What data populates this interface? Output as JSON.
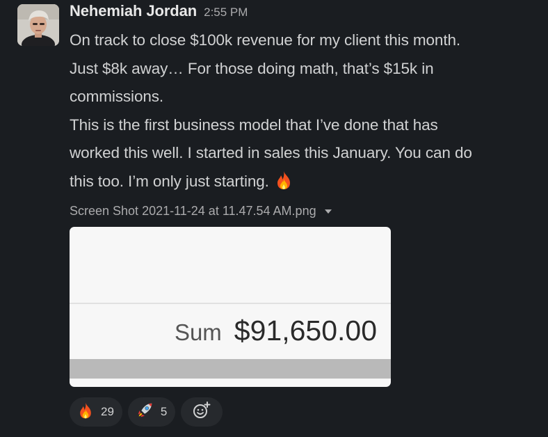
{
  "sender": {
    "name": "Nehemiah Jordan",
    "timestamp": "2:55 PM"
  },
  "message": {
    "lines": [
      "On track to close $100k revenue for my client this month.",
      "Just $8k away… For those doing math, that’s $15k in",
      "commissions.",
      "This is the first business model that I’ve done that has",
      "worked this well. I started in sales this January. You can do",
      "this too. I’m only just starting."
    ],
    "trailing_emoji": "fire-icon"
  },
  "attachment": {
    "filename": "Screen Shot 2021-11-24 at 11.47.54 AM.png",
    "sum_label": "Sum",
    "sum_value": "$91,650.00"
  },
  "reactions": [
    {
      "icon": "fire-icon",
      "count": "29"
    },
    {
      "icon": "rocket-icon",
      "count": "5"
    }
  ],
  "add_reaction_icon": "add-reaction-icon",
  "colors": {
    "background": "#1a1d21",
    "text": "#d1d2d3",
    "muted": "#ababad",
    "pill": "#26292d"
  }
}
